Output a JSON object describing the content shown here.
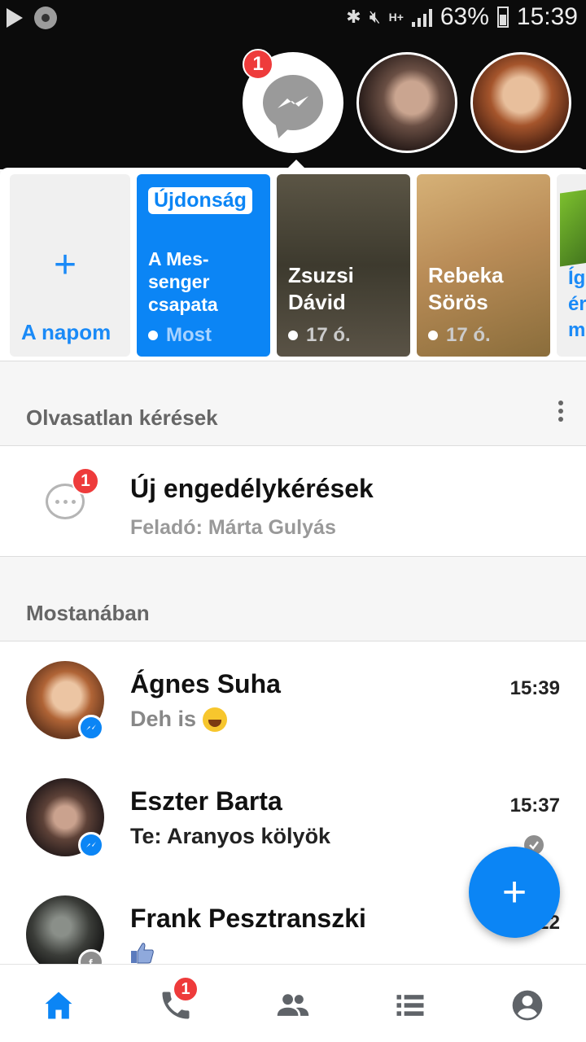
{
  "status_bar": {
    "battery": "63%",
    "time": "15:39",
    "network": "H+"
  },
  "chat_heads": {
    "badge": "1"
  },
  "stories": {
    "add": {
      "label": "A napom"
    },
    "news": {
      "pill": "Újdonság",
      "text": "A Mes-senger csapata",
      "time": "Most"
    },
    "items": [
      {
        "name_line1": "Zsuzsi",
        "name_line2": "Dávid",
        "ago": "17 ó."
      },
      {
        "name_line1": "Rebeka",
        "name_line2": "Sörös",
        "ago": "17 ó."
      }
    ],
    "partial_text": "Íg\nér\nm"
  },
  "requests_section": {
    "title": "Olvasatlan kérések",
    "row": {
      "title": "Új engedélykérések",
      "subtitle": "Feladó: Márta Gulyás",
      "badge": "1"
    }
  },
  "recent_section": {
    "title": "Mostanában"
  },
  "conversations": [
    {
      "name": "Ágnes Suha",
      "message": "Deh is",
      "time": "15:39"
    },
    {
      "name": "Eszter Barta",
      "message": "Te: Aranyos kölyök",
      "time": "15:37"
    },
    {
      "name": "Frank Pesztranszki",
      "message": "",
      "time": "22"
    }
  ],
  "bottom_nav": {
    "calls_badge": "1"
  },
  "colors": {
    "accent": "#0b85f5",
    "badge": "#ee3b3b"
  }
}
